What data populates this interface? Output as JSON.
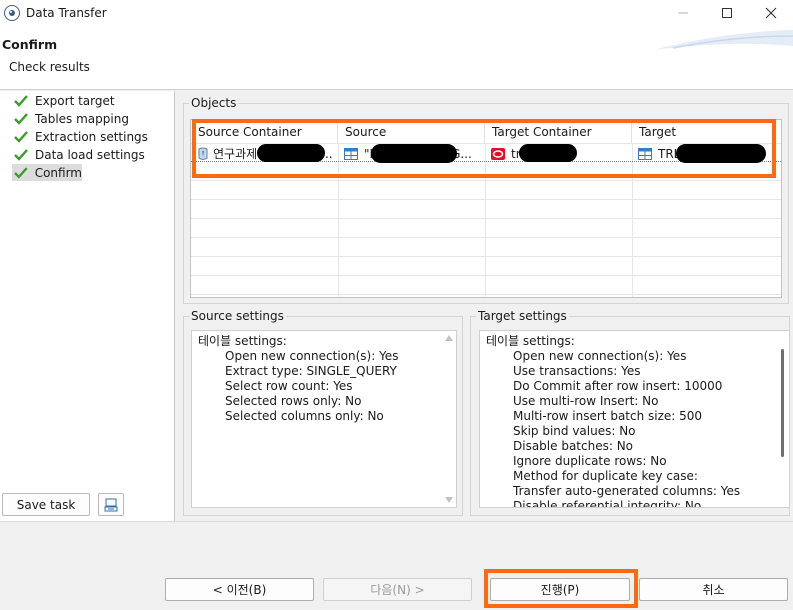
{
  "window": {
    "title": "Data Transfer"
  },
  "header": {
    "title": "Confirm",
    "subtitle": "Check results"
  },
  "steps": [
    {
      "label": "Export target",
      "done": true
    },
    {
      "label": "Tables mapping",
      "done": true
    },
    {
      "label": "Extraction settings",
      "done": true
    },
    {
      "label": "Data load settings",
      "done": true
    },
    {
      "label": "Confirm",
      "done": true,
      "active": true
    }
  ],
  "left_buttons": {
    "save_task": "Save task"
  },
  "objects": {
    "label": "Objects",
    "columns": [
      "Source Container",
      "Source",
      "Target Container",
      "Target"
    ],
    "row": {
      "source_container": "연구과제",
      "source_container_tail": "...",
      "source": "\"I",
      "source_tail": "G...",
      "target_container": "tr",
      "target": "TRL"
    }
  },
  "source_settings": {
    "label": "Source settings",
    "heading": "테이블 settings:",
    "lines": [
      "Open new connection(s): Yes",
      "Extract type: SINGLE_QUERY",
      "Select row count: Yes",
      "Selected rows only: No",
      "Selected columns only: No"
    ]
  },
  "target_settings": {
    "label": "Target settings",
    "heading": "테이블 settings:",
    "lines": [
      "Open new connection(s): Yes",
      "Use transactions: Yes",
      "Do Commit after row insert: 10000",
      "Use multi-row Insert: No",
      "Multi-row insert batch size: 500",
      "Skip bind values: No",
      "Disable batches: No",
      "Ignore duplicate rows: No",
      "Method for duplicate key case:",
      "Transfer auto-generated columns: Yes",
      "Disable referential integrity: No"
    ]
  },
  "nav": {
    "back": "< 이전(B)",
    "next": "다음(N) >",
    "proceed": "진행(P)",
    "cancel": "취소"
  },
  "colors": {
    "highlight": "#ff6a10",
    "check": "#3c9a2c",
    "oracle": "#e0102a",
    "table_icon": "#2f7fc9"
  }
}
